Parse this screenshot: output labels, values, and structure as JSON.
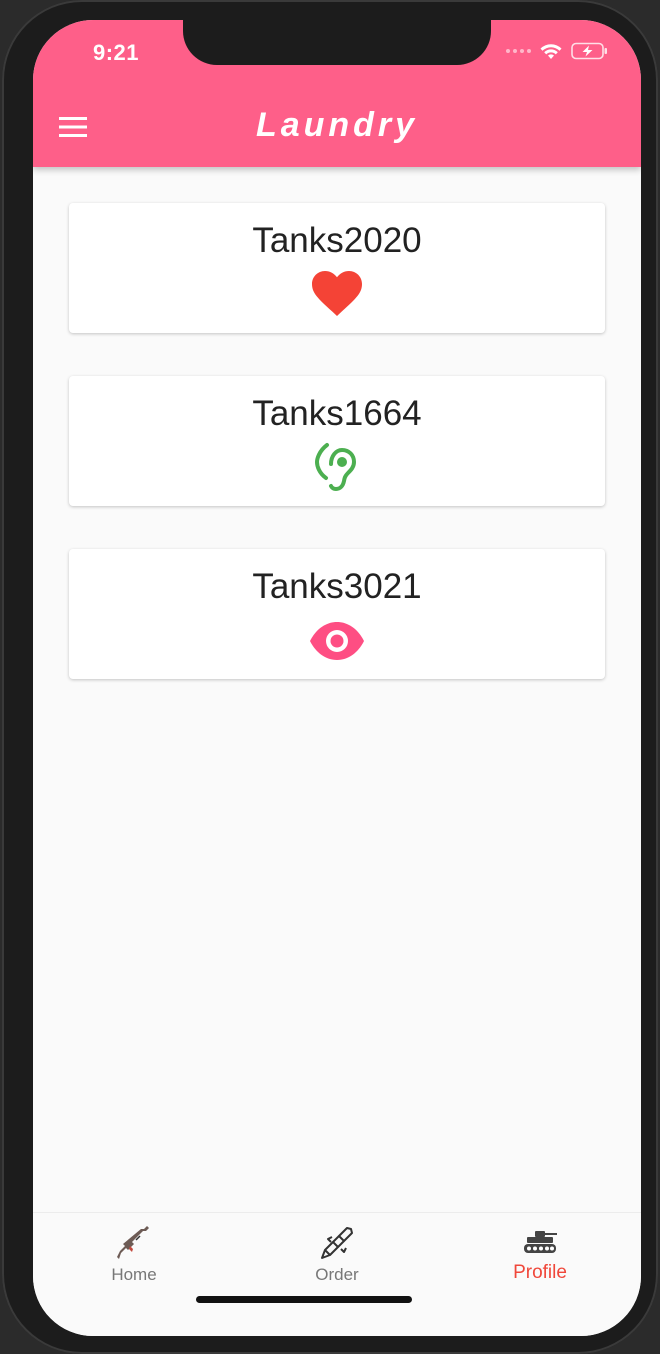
{
  "status_bar": {
    "time": "9:21",
    "icons": [
      "signal-dots-icon",
      "wifi-icon",
      "battery-charging-icon"
    ]
  },
  "app_bar": {
    "title": "Laundry",
    "menu_icon": "hamburger-menu-icon",
    "color": "#fe5f89"
  },
  "cards": [
    {
      "title": "Tanks2020",
      "icon": "heart-icon",
      "icon_color": "#f44336"
    },
    {
      "title": "Tanks1664",
      "icon": "hearing-icon",
      "icon_color": "#4caf50"
    },
    {
      "title": "Tanks3021",
      "icon": "eye-icon",
      "icon_color": "#fe4e83"
    }
  ],
  "bottom_nav": {
    "items": [
      {
        "label": "Home",
        "icon": "rifle-icon",
        "active": false
      },
      {
        "label": "Order",
        "icon": "rocket-icon",
        "active": false
      },
      {
        "label": "Profile",
        "icon": "tank-icon",
        "active": true
      }
    ],
    "active_color": "#f0473a"
  }
}
